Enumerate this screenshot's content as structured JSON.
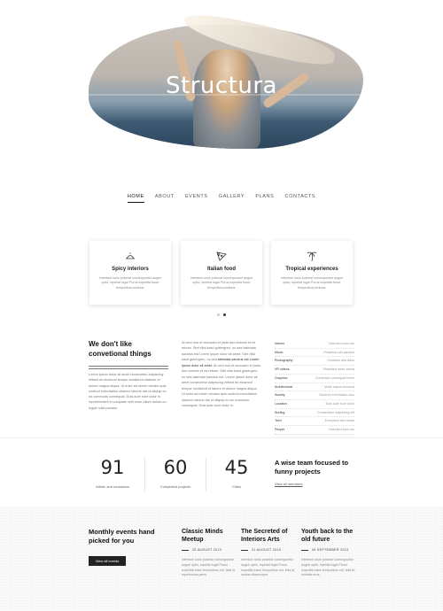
{
  "hero": {
    "title": "Structura"
  },
  "nav": {
    "items": [
      "HOME",
      "ABOUT",
      "EVENTS",
      "GALLERY",
      "PLANS",
      "CONTACTS"
    ]
  },
  "features": [
    {
      "icon": "dish-icon",
      "title": "Spicy interiors",
      "text": "Interdum iusto pulvinar consequuntur augue optio, repellat fuga! Purus expedita fusce temporibus portiuns."
    },
    {
      "icon": "pizza-slice-icon",
      "title": "Italian food",
      "text": "Interdum iusto pulvinar consequuntur augue optio, repellat fuga! Purus expedita fusce temporibus portiuns."
    },
    {
      "icon": "palm-tree-icon",
      "title": "Tropical experiences",
      "text": "Interdum iusto pulvinar consequuntur augue optio, repellat fuga! Purus expedita fusce temporibus portiuns."
    }
  ],
  "about": {
    "heading": "We don't like convetional things",
    "para": "Lorem ipsum dolor sit amet consectetur adipiscing elitsed do eiusmod tempor incididunt utlabore et dolore magna aliqua. Ut enim ad minim veniam quis nostrud exercitation ullamco laboris nisi ut aliquip ex ea commodo consequat. Duis aute irure dolor in reprehenderit in voluptate velit esse cillum dolore eu fugiat nulla pariatur.",
    "col2_a": "At vero eos et accusam et justo duo dolores et ea rebum. Stet clita kasd gubergren, no sea takimata sanctus est Lorem ipsum dolor sit amet. Stet clita kasd gubergren, no sea",
    "col2_b": "takimata sanctus est Lorem ipsum dolor sit amet.",
    "col2_c": "At vero eos et accusam et justo duo dolores et ea rebum. Stet clita kasd gubergren, no sea takimata sanctus est. Lorem ipsum dolor sit amet consectetur adipiscing elitsed do eiusmod tempor incididunt ut labore et dolore magna aliqua. Ut enim ad minim veniam quis nostrud exercitation ullamco laboris nisi ut aliquip ex ea commodo consequat. Duis aute irure dolor in."
  },
  "specs": [
    {
      "k": "Interns",
      "v": "Interdum iusto alo"
    },
    {
      "k": "Music",
      "v": "Phasellus alo sanctus"
    },
    {
      "k": "Photography",
      "v": "Curabitur alla tellus"
    },
    {
      "k": "VR videos",
      "v": "Phasellus alete urtusa"
    },
    {
      "k": "Graphics",
      "v": "Commodo consequat lorem"
    },
    {
      "k": "Architectural",
      "v": "Morbi sapus eiusmod"
    },
    {
      "k": "Society",
      "v": "Nostrud exercitation nisu"
    },
    {
      "k": "Location",
      "v": "Duis aute irure dolor"
    },
    {
      "k": "Surfing",
      "v": "Consectetur adipiscing elit"
    },
    {
      "k": "Tech",
      "v": "Excepteur sint occae"
    },
    {
      "k": "People",
      "v": "Interdum iusto alo"
    }
  ],
  "stats": [
    {
      "num": "91",
      "label": "Artists and musicians"
    },
    {
      "num": "60",
      "label": "Completed projects"
    },
    {
      "num": "45",
      "label": "Cities"
    }
  ],
  "team": {
    "heading": "A wise team focused to funny projects",
    "link": "View all members"
  },
  "events": {
    "heading": "Monthly events hand picked for you",
    "button": "View all events",
    "items": [
      {
        "title": "Classic Minds Meetup",
        "date": "25 AUGUST 2019",
        "text": "Interdum iusto pulvinar consequuntur augue optio, repellat fuga! Purus expedita fusce temporibus est, felis id, repellendus perm."
      },
      {
        "title": "The Secreted of Interiors Arts",
        "date": "31 AUGUST 2019",
        "text": "Interdum iusto pulvinar consequuntur augue optio, repellat fuga! Purus expedita fusce temporibus est, felis id, molius ullamcorper."
      },
      {
        "title": "Youth back to the old future",
        "date": "09 SEPTEMBER 2019",
        "text": "Interdum iusto pulvinar consequuntur augue optio, repellat fuga! Purus expedita fusce temporibus est, felis id, veritatis eros."
      }
    ]
  }
}
